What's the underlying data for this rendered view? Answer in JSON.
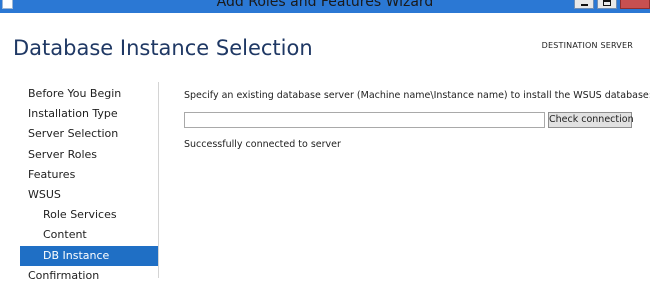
{
  "window": {
    "title": "Add Roles and Features Wizard"
  },
  "header": {
    "page_title": "Database Instance Selection",
    "destination_server": "DESTINATION SERVER"
  },
  "nav": {
    "items": [
      {
        "label": "Before You Begin"
      },
      {
        "label": "Installation Type"
      },
      {
        "label": "Server Selection"
      },
      {
        "label": "Server Roles"
      },
      {
        "label": "Features"
      },
      {
        "label": "WSUS"
      },
      {
        "label": "Role Services"
      },
      {
        "label": "Content"
      },
      {
        "label": "DB Instance"
      },
      {
        "label": "Confirmation"
      }
    ],
    "active_index": 8
  },
  "content": {
    "instruction": "Specify an existing database server (Machine name\\Instance name) to install the WSUS database:",
    "db_input": {
      "value": "",
      "placeholder": ""
    },
    "check_button_label": "Check connection",
    "status_text": "Successfully connected to server"
  },
  "colors": {
    "titlebar": "#2b78d4",
    "nav_active": "#1f6fc5",
    "page_title": "#1f3864"
  }
}
